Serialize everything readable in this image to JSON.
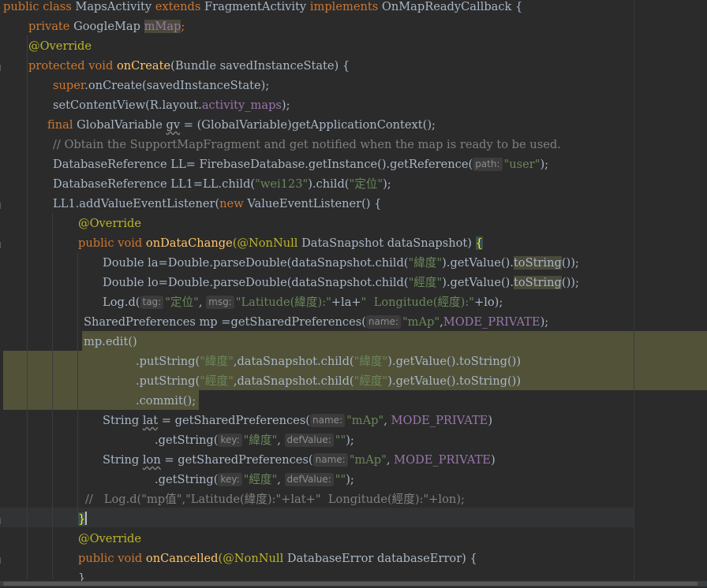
{
  "editor": {
    "lines": [
      {
        "kw1": "public class ",
        "cls": "MapsActivity ",
        "kw2": "extends ",
        "parent": "FragmentActivity ",
        "kw3": "implements ",
        "iface": "OnMapReadyCallback {"
      },
      {
        "kw": "private ",
        "type": "GoogleMap ",
        "field": "mMap",
        "semi": ";"
      },
      {
        "ann": "@Override"
      },
      {
        "kw": "protected void ",
        "fn": "onCreate",
        "rest": "(Bundle savedInstanceState) {"
      },
      {
        "kw": "super",
        "rest": ".onCreate(savedInstanceState);"
      },
      {
        "a": "setContentView(R.layout.",
        "field": "activity_maps",
        "b": ");"
      },
      {
        "kw": "final ",
        "a": "GlobalVariable ",
        "var": "gv",
        "b": " = (GlobalVariable)getApplicationContext();"
      },
      {
        "cmt": "// Obtain the SupportMapFragment and get notified when the map is ready to be used."
      },
      {
        "a": "DatabaseReference LL= FirebaseDatabase.getInstance().getReference(",
        "hint": "path:",
        "str": "\"user\"",
        "b": ");"
      },
      {
        "a": "DatabaseReference LL1=LL.child(",
        "str1": "\"wei123\"",
        "b": ").child(",
        "str2": "\"定位\"",
        "c": ");"
      },
      {
        "a": "LL1.addValueEventListener(",
        "kw": "new ",
        "b": "ValueEventListener() {"
      },
      {
        "ann": "@Override"
      },
      {
        "kw": "public void ",
        "fn": "onDataChange",
        "ann": "(@NonNull ",
        "rest": "DataSnapshot dataSnapshot) ",
        "brace": "{"
      },
      {
        "a": "Double la=Double.parseDouble(dataSnapshot.child(",
        "str": "\"緯度\"",
        "b": ").getValue().",
        "warn": "toString",
        "c": "());"
      },
      {
        "a": "Double lo=Double.parseDouble(dataSnapshot.child(",
        "str": "\"經度\"",
        "b": ").getValue().",
        "warn": "toString",
        "c": "());"
      },
      {
        "a": "Log.d(",
        "hint1": "tag:",
        "str1": "\"定位\"",
        "b": ", ",
        "hint2": "msg:",
        "str2": "\"Latitude(緯度):\"",
        "c": "+la+",
        "str3": "\"  Longitude(經度):\"",
        "d": "+lo);"
      },
      {
        "a": "SharedPreferences mp =getSharedPreferences(",
        "hint": "name:",
        "str": "\"mAp\"",
        "b": ",",
        "fld": "MODE_PRIVATE",
        "c": ");"
      },
      {
        "a": "mp.edit()"
      },
      {
        "a": ".putString(",
        "str1": "\"緯度\"",
        "b": ",dataSnapshot.child(",
        "str2": "\"緯度\"",
        "c": ").getValue().toString())"
      },
      {
        "a": ".putString(",
        "str1": "\"經度\"",
        "b": ",dataSnapshot.child(",
        "str2": "\"經度\"",
        "c": ").getValue().toString())"
      },
      {
        "a": ".commit();"
      },
      {
        "a": "String ",
        "var": "lat",
        "b": " = getSharedPreferences(",
        "hint": "name:",
        "str": "\"mAp\"",
        "c": ", ",
        "fld": "MODE_PRIVATE",
        "d": ")"
      },
      {
        "a": ".getString(",
        "hint1": "key:",
        "str1": "\"緯度\"",
        "b": ", ",
        "hint2": "defValue:",
        "str2": "\"\"",
        "c": ");"
      },
      {
        "a": "String ",
        "var": "lon",
        "b": " = getSharedPreferences(",
        "hint": "name:",
        "str": "\"mAp\"",
        "c": ", ",
        "fld": "MODE_PRIVATE",
        "d": ")"
      },
      {
        "a": ".getString(",
        "hint1": "key:",
        "str1": "\"經度\"",
        "b": ", ",
        "hint2": "defValue:",
        "str2": "\"\"",
        "c": ");"
      },
      {
        "cmt": "//   Log.d(\"mp值\",\"Latitude(緯度):\"+lat+\"  Longitude(經度):\"+lon);"
      },
      {
        "brace": "}"
      },
      {
        "ann": "@Override"
      },
      {
        "kw": "public void ",
        "fn": "onCancelled",
        "ann": "(@NonNull ",
        "rest": "DatabaseError databaseError) {"
      },
      {
        "a": "}"
      }
    ]
  }
}
